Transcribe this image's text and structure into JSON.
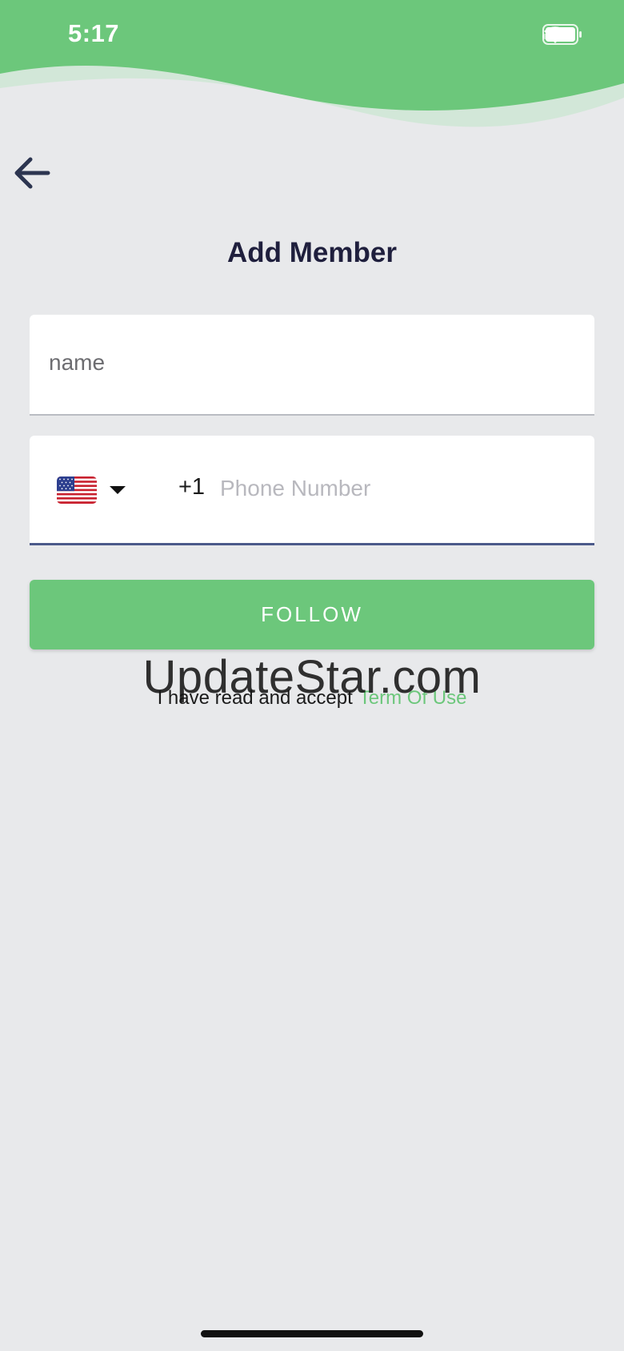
{
  "status_bar": {
    "time": "5:17"
  },
  "colors": {
    "accent": "#6cc77b",
    "background": "#e8e9eb",
    "title": "#1f1f3d",
    "phone_underline": "#4b5a8a"
  },
  "header": {
    "back_icon": "arrow-left-icon",
    "title": "Add Member"
  },
  "form": {
    "name_placeholder": "name",
    "name_value": "",
    "country_flag": "us-flag-icon",
    "dial_code": "+1",
    "phone_placeholder": "Phone Number",
    "phone_value": ""
  },
  "follow_button": {
    "label": "FOLLOW"
  },
  "terms": {
    "prefix": "I have read and accept",
    "link": "Term Of Use"
  },
  "watermark": {
    "text": "UpdateStar.com"
  }
}
